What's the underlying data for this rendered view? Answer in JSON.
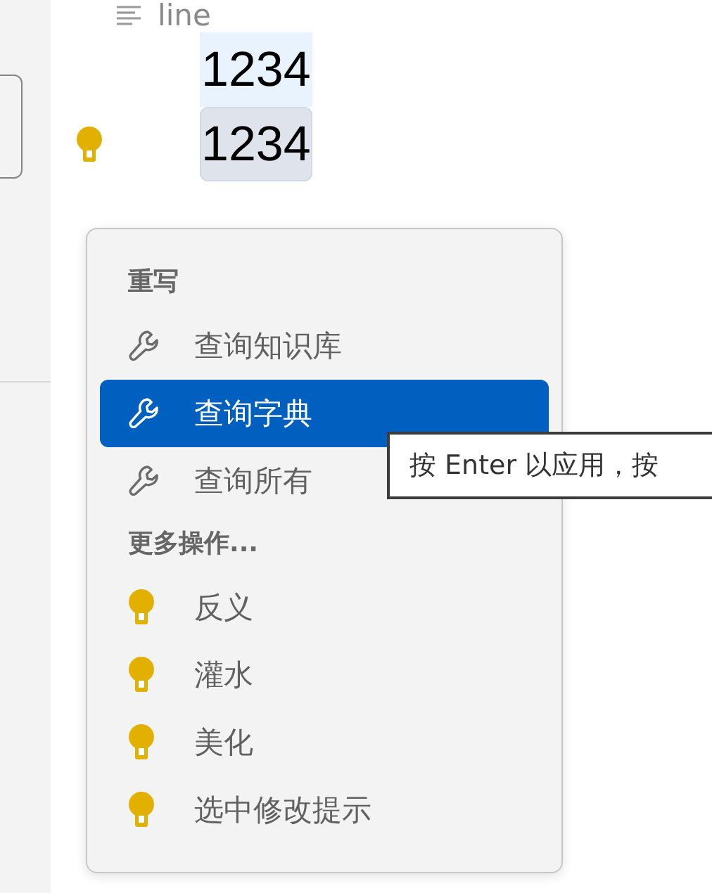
{
  "outline": {
    "label": "line"
  },
  "code_lines": [
    {
      "text": "1234",
      "selected": false,
      "lightbulb": false
    },
    {
      "text": "1234",
      "selected": true,
      "lightbulb": true
    }
  ],
  "menu": [
    {
      "kind": "header",
      "label": "重写"
    },
    {
      "kind": "action",
      "label": "查询知识库",
      "selected": false
    },
    {
      "kind": "action",
      "label": "查询字典",
      "selected": true
    },
    {
      "kind": "action",
      "label": "查询所有",
      "selected": false
    },
    {
      "kind": "header",
      "label": "更多操作..."
    },
    {
      "kind": "quickfix",
      "label": "反义",
      "selected": false
    },
    {
      "kind": "quickfix",
      "label": "灌水",
      "selected": false
    },
    {
      "kind": "quickfix",
      "label": "美化",
      "selected": false
    },
    {
      "kind": "quickfix",
      "label": "选中修改提示",
      "selected": false
    }
  ],
  "tooltip": {
    "text": "按 Enter 以应用，按"
  }
}
